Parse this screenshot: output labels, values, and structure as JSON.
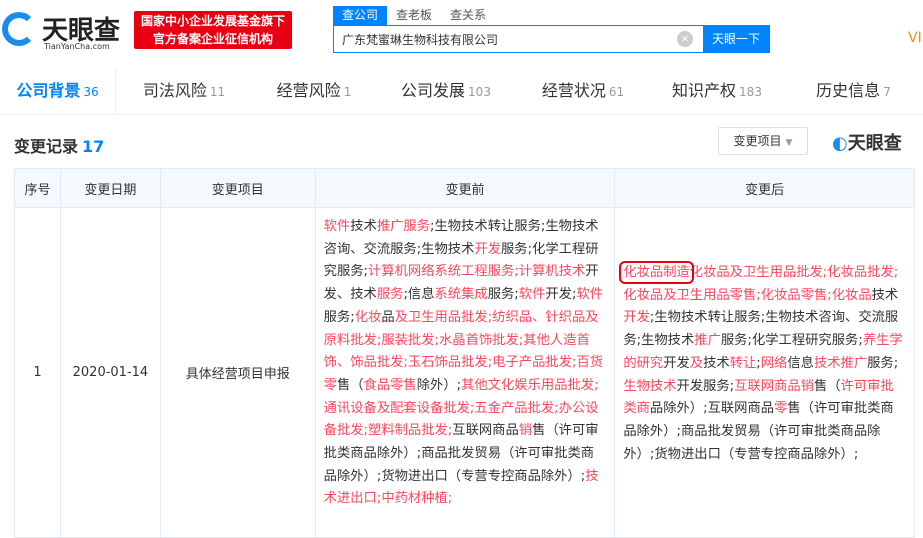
{
  "header": {
    "logo_name": "天眼查",
    "logo_domain": "TianYanCha.com",
    "badge_line1": "国家中小企业发展基金旗下",
    "badge_line2": "官方备案企业征信机构",
    "search_tabs": [
      "查公司",
      "查老板",
      "查关系"
    ],
    "search_value": "广东梵蜜琳生物科技有限公司",
    "search_button": "天眼一下",
    "vip": "VI"
  },
  "nav": [
    {
      "label": "公司背景",
      "count": "36"
    },
    {
      "label": "司法风险",
      "count": "11"
    },
    {
      "label": "经营风险",
      "count": "1"
    },
    {
      "label": "公司发展",
      "count": "103"
    },
    {
      "label": "经营状况",
      "count": "61"
    },
    {
      "label": "知识产权",
      "count": "183"
    },
    {
      "label": "历史信息",
      "count": "7"
    }
  ],
  "section": {
    "title": "变更记录",
    "count": "17",
    "filter_label": "变更项目",
    "watermark": "天眼查"
  },
  "table": {
    "headers": [
      "序号",
      "变更日期",
      "变更项目",
      "变更前",
      "变更后"
    ],
    "rows": [
      {
        "index": "1",
        "date": "2020-01-14",
        "item": "具体经营项目申报",
        "before": [
          {
            "t": "软件",
            "h": 1
          },
          {
            "t": "技术",
            "h": 0
          },
          {
            "t": "推广服务",
            "h": 1
          },
          {
            "t": ";生物技术转让服务;生物技术咨询、交流服务;生物技术",
            "h": 0
          },
          {
            "t": "开发",
            "h": 1
          },
          {
            "t": "服务;化学工程研究服务;",
            "h": 0
          },
          {
            "t": "计算机网络系统工程服务;计算机技术",
            "h": 1
          },
          {
            "t": "开发、技术",
            "h": 0
          },
          {
            "t": "服务",
            "h": 1
          },
          {
            "t": ";信息",
            "h": 0
          },
          {
            "t": "系统集成",
            "h": 1
          },
          {
            "t": "服务;",
            "h": 0
          },
          {
            "t": "软件",
            "h": 1
          },
          {
            "t": "开发;",
            "h": 0
          },
          {
            "t": "软件",
            "h": 1
          },
          {
            "t": "服务;",
            "h": 0
          },
          {
            "t": "化妆",
            "h": 1
          },
          {
            "t": "品",
            "h": 0
          },
          {
            "t": "及卫生用品批发;纺织品、针织品及原料批发;服装批发;水晶首饰批发;其他人造首饰、饰品批发;玉石饰品批发;电子产品批发;百货零",
            "h": 1
          },
          {
            "t": "售（",
            "h": 0
          },
          {
            "t": "食品零售",
            "h": 1
          },
          {
            "t": "除外）;",
            "h": 0
          },
          {
            "t": "其他文化娱乐用品批发;通讯设备及配套设备批发;五金产品批发;办公设备批发;塑料制品批发;",
            "h": 1
          },
          {
            "t": "互联网商品",
            "h": 0
          },
          {
            "t": "销",
            "h": 1
          },
          {
            "t": "售（许可审批类商品除外）;商品批发贸易（许可审批类商品除外）;货物进出口（专营专控商品除外）;",
            "h": 0
          },
          {
            "t": "技术进出口;中药材种植;",
            "h": 1
          }
        ],
        "after": [
          {
            "t": "化妆品制造",
            "h": 2
          },
          {
            "t": "化妆品及卫生用品批发;化妆品批发;化妆品及卫生用品零售;化妆品零售;化妆品",
            "h": 1
          },
          {
            "t": "技术",
            "h": 0
          },
          {
            "t": "开发",
            "h": 1
          },
          {
            "t": ";生物技术转让服务;生物技术咨询、交流服务;生物技术",
            "h": 0
          },
          {
            "t": "推广",
            "h": 1
          },
          {
            "t": "服务;化学工程研究服务;",
            "h": 0
          },
          {
            "t": "养生学的研究",
            "h": 1
          },
          {
            "t": "开发",
            "h": 0
          },
          {
            "t": "及",
            "h": 1
          },
          {
            "t": "技术",
            "h": 0
          },
          {
            "t": "转让",
            "h": 1
          },
          {
            "t": ";",
            "h": 0
          },
          {
            "t": "网络",
            "h": 1
          },
          {
            "t": "信息",
            "h": 0
          },
          {
            "t": "技术推广",
            "h": 1
          },
          {
            "t": "服务;",
            "h": 0
          },
          {
            "t": "生物技术",
            "h": 1
          },
          {
            "t": "开发服务;",
            "h": 0
          },
          {
            "t": "互联网商品销",
            "h": 1
          },
          {
            "t": "售（",
            "h": 0
          },
          {
            "t": "许可审批类商",
            "h": 1
          },
          {
            "t": "品除外）;互联网商品",
            "h": 0
          },
          {
            "t": "零",
            "h": 1
          },
          {
            "t": "售（许可审批类商品除外）;商品批发贸易（许可审批类商品除外）;货物进出口（专营专控商品除外）;",
            "h": 0
          }
        ]
      }
    ]
  },
  "colors": {
    "accent": "#0084ff",
    "highlight": "#fd485e",
    "badge": "#e60012"
  }
}
